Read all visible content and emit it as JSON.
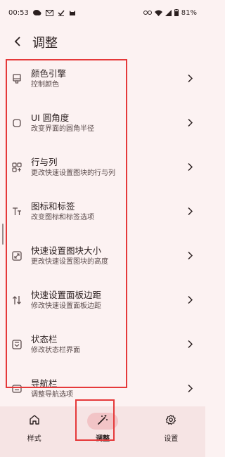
{
  "status_bar": {
    "time": "00:53",
    "battery": "81%",
    "icons": [
      "message-icon",
      "mail-icon",
      "check-icon",
      "cat-icon",
      "link-icon",
      "wifi-icon",
      "signal-icon",
      "battery-icon"
    ]
  },
  "app_bar": {
    "title": "调整",
    "back_icon": "arrow-back-icon"
  },
  "items": [
    {
      "title": "颜色引擎",
      "subtitle": "控制颜色",
      "icon": "palette-icon"
    },
    {
      "title": "UI 圆角度",
      "subtitle": "改变界面的圆角半径",
      "icon": "rounded-corner-icon"
    },
    {
      "title": "行与列",
      "subtitle": "更改快速设置图块的行与列",
      "icon": "grid-icon"
    },
    {
      "title": "图标和标签",
      "subtitle": "改变图标和标签选项",
      "icon": "text-format-icon"
    },
    {
      "title": "快速设置图块大小",
      "subtitle": "更改快速设置图块的高度",
      "icon": "resize-icon"
    },
    {
      "title": "快速设置面板边距",
      "subtitle": "修改快速设置面板边距",
      "icon": "swap-vertical-icon"
    },
    {
      "title": "状态栏",
      "subtitle": "修改状态栏界面",
      "icon": "status-bar-icon"
    },
    {
      "title": "导航栏",
      "subtitle": "调整导航选项",
      "icon": "navigation-bar-icon"
    }
  ],
  "bottom_nav": [
    {
      "label": "样式",
      "icon": "home-icon",
      "active": false
    },
    {
      "label": "调整",
      "icon": "magic-wand-icon",
      "active": true
    },
    {
      "label": "设置",
      "icon": "settings-icon",
      "active": false
    }
  ],
  "colors": {
    "background": "#fcf2f2",
    "nav_background": "#f6e4e4",
    "active_pill": "#f2c4c6",
    "annotation_red": "#e5393a"
  }
}
